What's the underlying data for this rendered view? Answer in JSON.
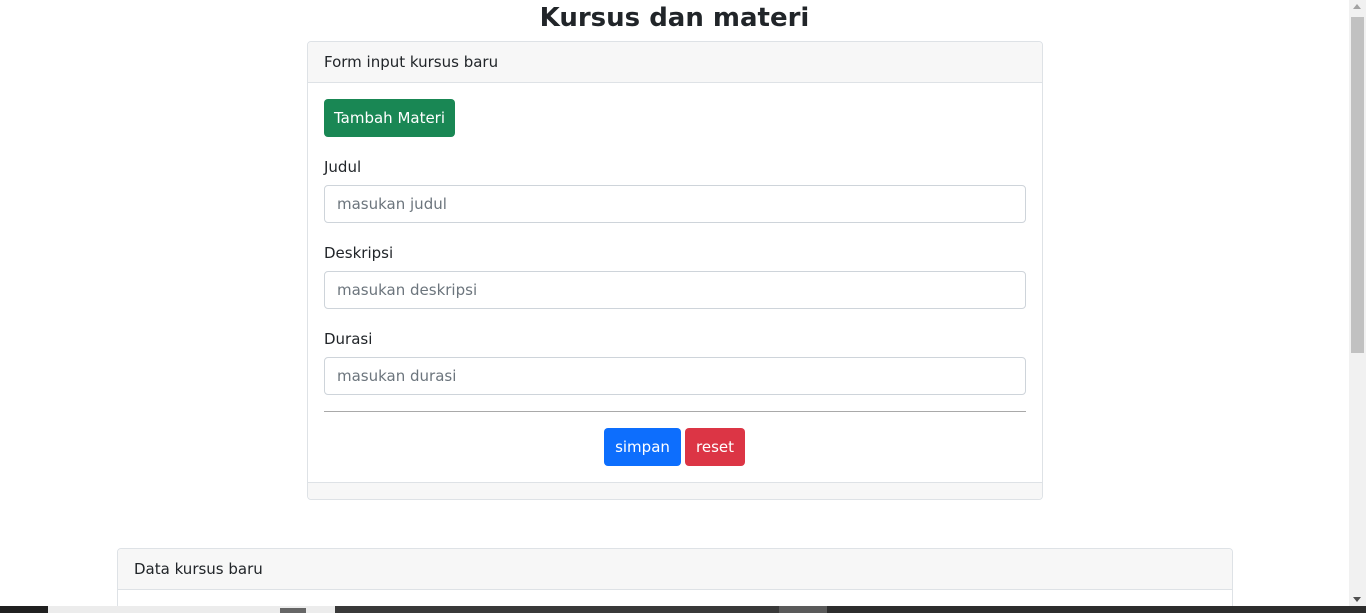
{
  "page": {
    "title": "Kursus dan materi"
  },
  "form_card": {
    "header": "Form input kursus baru",
    "add_button_label": "Tambah Materi",
    "fields": [
      {
        "label": "Judul",
        "placeholder": "masukan judul",
        "value": ""
      },
      {
        "label": "Deskripsi",
        "placeholder": "masukan deskripsi",
        "value": ""
      },
      {
        "label": "Durasi",
        "placeholder": "masukan durasi",
        "value": ""
      }
    ],
    "save_label": "simpan",
    "reset_label": "reset"
  },
  "data_card": {
    "header": "Data kursus baru"
  },
  "colors": {
    "success": "#198754",
    "primary": "#0d6efd",
    "danger": "#dc3545",
    "card_header_bg": "#f7f7f7",
    "border": "#dee2e6"
  }
}
